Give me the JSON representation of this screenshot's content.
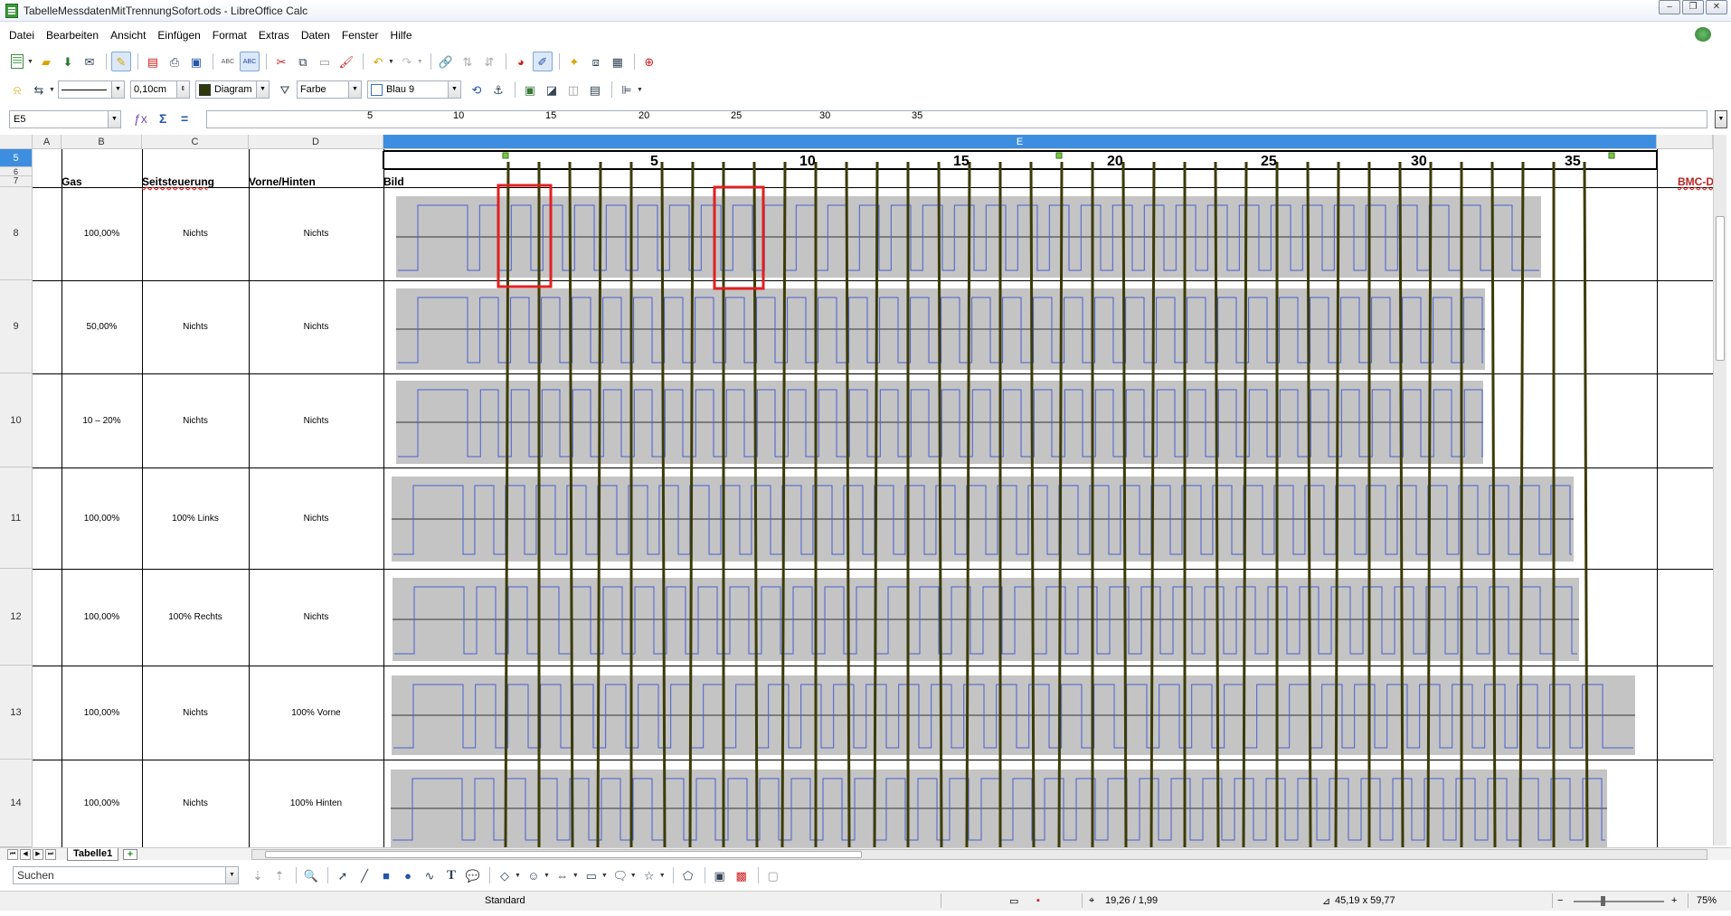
{
  "window": {
    "title": "TabelleMessdatenMitTrennungSofort.ods - LibreOffice Calc"
  },
  "menu": [
    "Datei",
    "Bearbeiten",
    "Ansicht",
    "Einfügen",
    "Format",
    "Extras",
    "Daten",
    "Fenster",
    "Hilfe"
  ],
  "draw_toolbar": {
    "line_width": "0,10cm",
    "line_color_name": "Diagram",
    "area_style": "Farbe",
    "area_color": "Blau 9"
  },
  "formula_bar": {
    "cell_ref": "E5",
    "ruler_ticks": [
      "5",
      "10",
      "15",
      "20",
      "25",
      "30",
      "35"
    ]
  },
  "columns": [
    "A",
    "B",
    "C",
    "D",
    "E"
  ],
  "ruler_numbers": [
    "5",
    "10",
    "15",
    "20",
    "25",
    "30",
    "35"
  ],
  "header_row": {
    "row": "7",
    "gas": "Gas",
    "seit": "Seitsteuerung",
    "vorne": "Vorne/Hinten",
    "bild": "Bild",
    "bmc": "BMC-D"
  },
  "row_labels": {
    "r5": "5",
    "r6": "6",
    "r7": "7"
  },
  "rows": [
    {
      "num": "8",
      "gas": "100,00%",
      "seit": "Nichts",
      "vorne": "Nichts"
    },
    {
      "num": "9",
      "gas": "50,00%",
      "seit": "Nichts",
      "vorne": "Nichts"
    },
    {
      "num": "10",
      "gas": "10 – 20%",
      "seit": "Nichts",
      "vorne": "Nichts"
    },
    {
      "num": "11",
      "gas": "100,00%",
      "seit": "100% Links",
      "vorne": "Nichts"
    },
    {
      "num": "12",
      "gas": "100,00%",
      "seit": "100% Rechts",
      "vorne": "Nichts"
    },
    {
      "num": "13",
      "gas": "100,00%",
      "seit": "Nichts",
      "vorne": "100% Vorne"
    },
    {
      "num": "14",
      "gas": "100,00%",
      "seit": "Nichts",
      "vorne": "100% Hinten"
    }
  ],
  "sheet_tabs": {
    "active": "Tabelle1"
  },
  "search": {
    "placeholder": "Suchen"
  },
  "status": {
    "page_style": "Standard",
    "position": "19,26 / 1,99",
    "size": "45,19 x 59,77",
    "zoom": "75%"
  },
  "colors": {
    "selection": "#3e8ee0",
    "signal": "#4a5ed0",
    "waveform_bg": "#c4c4c4",
    "marker": "#3b3b08",
    "highlight": "#e02020"
  }
}
